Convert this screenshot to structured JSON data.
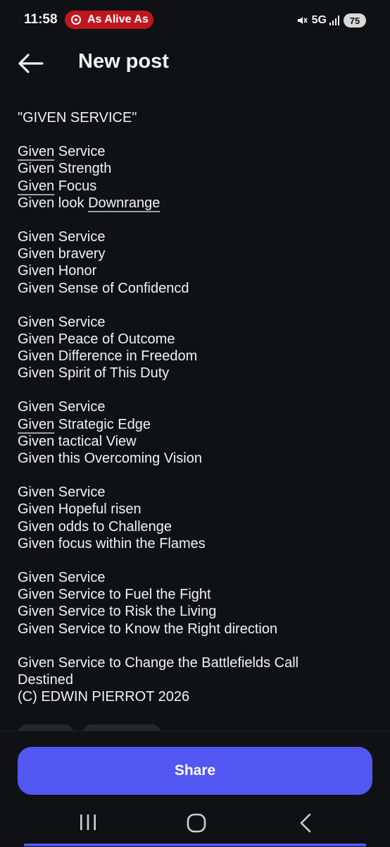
{
  "status_bar": {
    "time": "11:58",
    "notification": "As Alive As",
    "network": "5G",
    "battery": "75"
  },
  "header": {
    "title": "New post"
  },
  "post": {
    "title_line": "\"GIVEN SERVICE\"",
    "stanzas": [
      [
        "Given Service",
        "Given Strength",
        "Given Focus",
        "Given look Downrange"
      ],
      [
        "Given Service",
        "Given bravery",
        "Given Honor",
        "Given Sense of Confidencd"
      ],
      [
        "Given Service",
        "Given Peace of Outcome",
        "Given Difference in Freedom",
        "Given Spirit of This Duty"
      ],
      [
        "Given Service",
        "Given Strategic Edge",
        "Given tactical View",
        "Given this Overcoming Vision"
      ],
      [
        "Given Service",
        "Given Hopeful risen",
        "Given odds to Challenge",
        "Given focus within the Flames"
      ],
      [
        "Given Service",
        "Given Service to Fuel the Fight",
        "Given Service to Risk the Living",
        "Given Service to Know the Right direction"
      ],
      [
        "Given Service to Change the Battlefields Call",
        "Destined",
        "(C) EDWIN PIERROT 2026"
      ]
    ]
  },
  "actions": {
    "share_label": "Share"
  },
  "colors": {
    "background": "#0f1114",
    "accent": "#5157f0",
    "notification_pill": "#c0171e"
  }
}
